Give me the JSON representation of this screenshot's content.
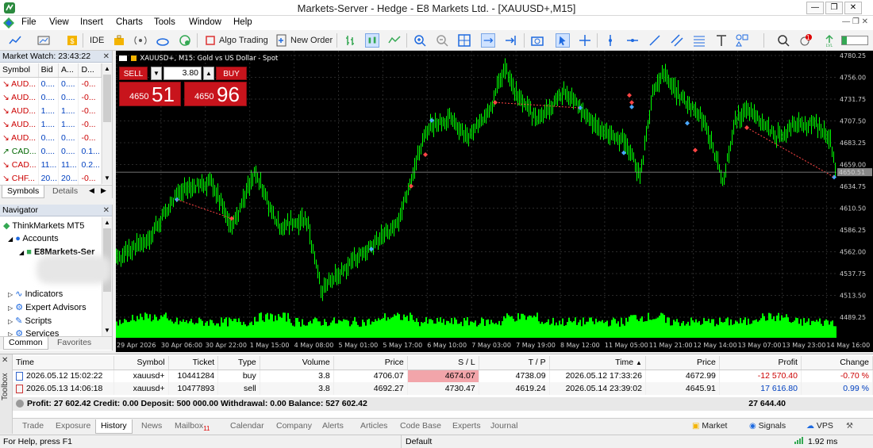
{
  "window": {
    "title": "Markets-Server - Hedge - E8 Markets Ltd. - [XAUUSD+,M15]"
  },
  "menu": [
    "File",
    "View",
    "Insert",
    "Charts",
    "Tools",
    "Window",
    "Help"
  ],
  "toolbar": {
    "ide_label": "IDE",
    "algo_label": "Algo Trading",
    "new_order_label": "New Order",
    "signals_badge": "1"
  },
  "market_watch": {
    "title": "Market Watch: 23:43:22",
    "headers": [
      "Symbol",
      "Bid",
      "A...",
      "D..."
    ],
    "rows": [
      {
        "symbol": "AUD...",
        "bid": "0....",
        "ask": "0....",
        "d": "-0...",
        "color": "red"
      },
      {
        "symbol": "AUD...",
        "bid": "0....",
        "ask": "0....",
        "d": "-0...",
        "color": "red"
      },
      {
        "symbol": "AUD...",
        "bid": "1....",
        "ask": "1....",
        "d": "-0...",
        "color": "red"
      },
      {
        "symbol": "AUD...",
        "bid": "1....",
        "ask": "1....",
        "d": "-0...",
        "color": "red"
      },
      {
        "symbol": "AUD...",
        "bid": "0....",
        "ask": "0....",
        "d": "-0...",
        "color": "red"
      },
      {
        "symbol": "CAD...",
        "bid": "0....",
        "ask": "0....",
        "d": "0.1...",
        "color": "green"
      },
      {
        "symbol": "CAD...",
        "bid": "11...",
        "ask": "11...",
        "d": "0.2...",
        "color": "red"
      },
      {
        "symbol": "CHF...",
        "bid": "20...",
        "ask": "20...",
        "d": "-0...",
        "color": "red"
      }
    ],
    "tabs": [
      "Symbols",
      "Details"
    ]
  },
  "navigator": {
    "title": "Navigator",
    "items": [
      "ThinkMarkets MT5",
      "Accounts",
      "E8Markets-Ser",
      "Indicators",
      "Expert Advisors",
      "Scripts",
      "Services"
    ],
    "tabs": [
      "Common",
      "Favorites"
    ]
  },
  "chart": {
    "label": "XAUUSD+, M15:  Gold vs US Dollar - Spot",
    "sell_label": "SELL",
    "buy_label": "BUY",
    "volume": "3.80",
    "sell_price_small": "4650",
    "sell_price_big": "51",
    "buy_price_small": "4650",
    "buy_price_big": "96",
    "current_price": "4650.51",
    "y_ticks": [
      "4780.25",
      "4756.00",
      "4731.75",
      "4707.50",
      "4683.25",
      "4659.00",
      "4634.75",
      "4610.50",
      "4586.25",
      "4562.00",
      "4537.75",
      "4513.50",
      "4489.25"
    ],
    "x_ticks": [
      "29 Apr 2026",
      "30 Apr 06:00",
      "30 Apr 22:00",
      "1 May 15:00",
      "4 May 08:00",
      "5 May 01:00",
      "5 May 17:00",
      "6 May 10:00",
      "7 May 03:00",
      "7 May 19:00",
      "8 May 12:00",
      "11 May 05:00",
      "11 May 21:00",
      "12 May 14:00",
      "13 May 07:00",
      "13 May 23:00",
      "14 May 16:00"
    ],
    "colors": {
      "candles": "#00ff00",
      "background": "#000000",
      "grid": "#2a2a2a"
    }
  },
  "history": {
    "headers": [
      "Time",
      "Symbol",
      "Ticket",
      "Type",
      "Volume",
      "Price",
      "S / L",
      "T / P",
      "Time",
      "Price",
      "Profit",
      "Change"
    ],
    "rows": [
      {
        "time": "2026.05.12 15:02:22",
        "symbol": "xauusd+",
        "ticket": "10441284",
        "type": "buy",
        "volume": "3.8",
        "price": "4706.07",
        "sl": "4674.07",
        "tp": "4738.09",
        "close_time": "2026.05.12 17:33:26",
        "close_price": "4672.99",
        "profit": "-12 570.40",
        "change": "-0.70 %"
      },
      {
        "time": "2026.05.13 14:06:18",
        "symbol": "xauusd+",
        "ticket": "10477893",
        "type": "sell",
        "volume": "3.8",
        "price": "4692.27",
        "sl": "4730.47",
        "tp": "4619.24",
        "close_time": "2026.05.14 23:39:02",
        "close_price": "4645.91",
        "profit": "17 616.80",
        "change": "0.99 %"
      }
    ],
    "summary": "Profit: 27 602.42  Credit: 0.00  Deposit: 500 000.00  Withdrawal: 0.00  Balance: 527 602.42",
    "summary_total": "27 644.40"
  },
  "toolbox_label": "Toolbox",
  "bottom_tabs": [
    "Trade",
    "Exposure",
    "History",
    "News",
    "Mailbox",
    "Calendar",
    "Company",
    "Alerts",
    "Articles",
    "Code Base",
    "Experts",
    "Journal"
  ],
  "mailbox_badge": "11",
  "bottom_right": [
    "Market",
    "Signals",
    "VPS",
    "Tester"
  ],
  "status": {
    "help": "For Help, press F1",
    "profile": "Default",
    "ping": "1.92 ms"
  }
}
